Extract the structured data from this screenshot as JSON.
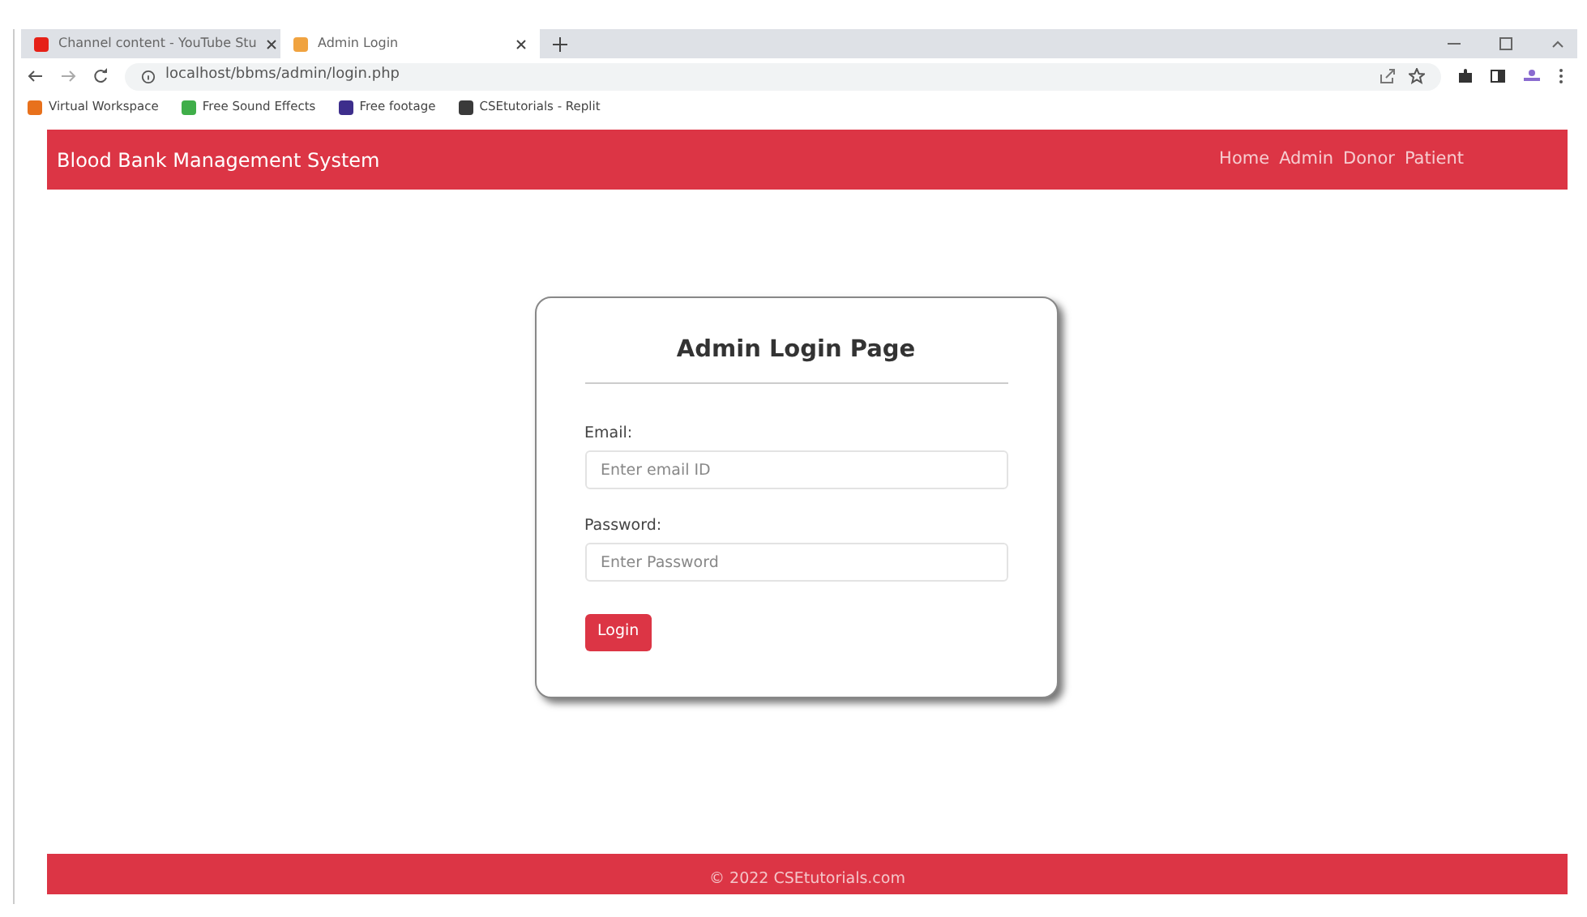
{
  "browser": {
    "tabs": [
      {
        "title": "Channel content - YouTube Stu",
        "color": "#e62117",
        "selected": false
      },
      {
        "title": "Admin Login",
        "color": "#f0a340",
        "selected": true
      }
    ],
    "url": "localhost/bbms/admin/login.php",
    "bookmarks": [
      {
        "label": "Virtual Workspace",
        "color": "#e8711c"
      },
      {
        "label": "Free Sound Effects",
        "color": "#3fae49"
      },
      {
        "label": "Free footage",
        "color": "#3d2e8c"
      },
      {
        "label": "CSEtutorials - Replit",
        "color": "#3a3a3a"
      }
    ]
  },
  "navbar": {
    "brand": "Blood Bank Management System",
    "links": [
      "Home",
      "Admin",
      "Donor",
      "Patient"
    ]
  },
  "login": {
    "title": "Admin Login Page",
    "fields": [
      {
        "label": "Email:",
        "placeholder": "Enter email ID"
      },
      {
        "label": "Password:",
        "placeholder": "Enter Password"
      }
    ],
    "button": "Login"
  },
  "footer": "© 2022 CSEtutorials.com"
}
